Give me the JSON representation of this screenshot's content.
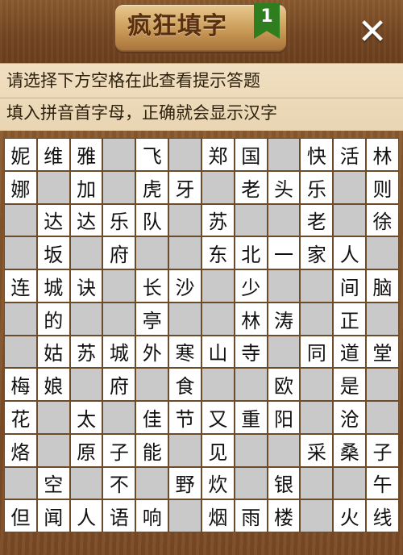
{
  "header": {
    "title": "疯狂填字",
    "level": "1",
    "close_symbol": "✕"
  },
  "hint": {
    "line1": "请选择下方空格在此查看提示答题",
    "line2": "填入拼音首字母，正确就会显示汉字"
  },
  "grid": [
    [
      "妮",
      "维",
      "雅",
      "#",
      "飞",
      "#",
      "郑",
      "国",
      "#",
      "快",
      "活",
      "林"
    ],
    [
      "娜",
      "#",
      "加",
      "#",
      "虎",
      "牙",
      "#",
      "老",
      "头",
      "乐",
      "#",
      "则"
    ],
    [
      "#",
      "达",
      "达",
      "乐",
      "队",
      "#",
      "苏",
      "#",
      "#",
      "老",
      "#",
      "徐"
    ],
    [
      "#",
      "坂",
      "#",
      "府",
      "#",
      "#",
      "东",
      "北",
      "一",
      "家",
      "人",
      "#"
    ],
    [
      "连",
      "城",
      "诀",
      "#",
      "长",
      "沙",
      "#",
      "少",
      "#",
      "#",
      "间",
      "脑"
    ],
    [
      "#",
      "的",
      "#",
      "#",
      "亭",
      "#",
      "#",
      "林",
      "涛",
      "#",
      "正",
      "#"
    ],
    [
      "#",
      "姑",
      "苏",
      "城",
      "外",
      "寒",
      "山",
      "寺",
      "#",
      "同",
      "道",
      "堂"
    ],
    [
      "梅",
      "娘",
      "#",
      "府",
      "#",
      "食",
      "#",
      "#",
      "欧",
      "#",
      "是",
      "#"
    ],
    [
      "花",
      "#",
      "太",
      "#",
      "佳",
      "节",
      "又",
      "重",
      "阳",
      "#",
      "沧",
      "#"
    ],
    [
      "烙",
      "#",
      "原",
      "子",
      "能",
      "#",
      "见",
      "#",
      "#",
      "采",
      "桑",
      "子"
    ],
    [
      "#",
      "空",
      "#",
      "不",
      "#",
      "野",
      "炊",
      "#",
      "银",
      "#",
      "#",
      "午"
    ],
    [
      "但",
      "闻",
      "人",
      "语",
      "响",
      "#",
      "烟",
      "雨",
      "楼",
      "#",
      "火",
      "线"
    ]
  ]
}
